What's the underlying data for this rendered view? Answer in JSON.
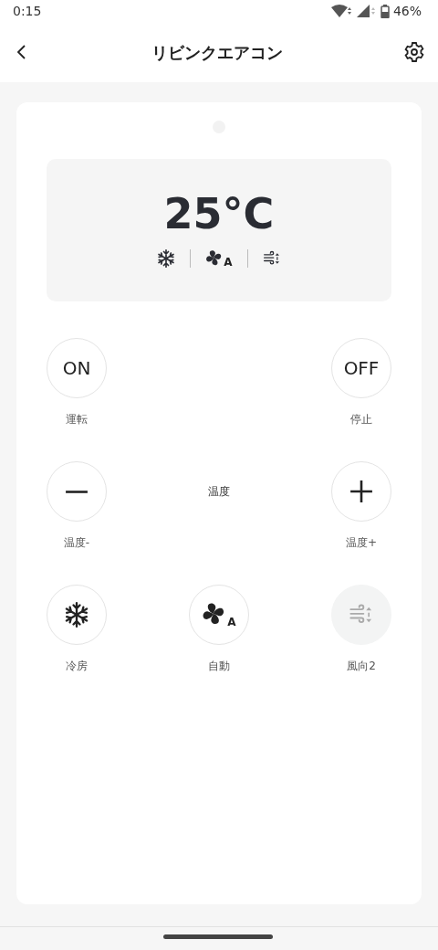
{
  "status_bar": {
    "time": "0:15",
    "battery": "46%"
  },
  "header": {
    "title": "リビンクエアコン"
  },
  "display": {
    "temperature": "25°C",
    "indicators": [
      {
        "kind": "snowflake"
      },
      {
        "kind": "fan",
        "letter": "A"
      },
      {
        "kind": "swing"
      }
    ]
  },
  "rows": [
    {
      "left": {
        "kind": "text",
        "text": "ON",
        "label": "運転",
        "disabled": false
      },
      "right": {
        "kind": "text",
        "text": "OFF",
        "label": "停止",
        "disabled": false
      }
    },
    {
      "left": {
        "kind": "minus",
        "label": "温度-",
        "disabled": false
      },
      "center": {
        "kind": "caption",
        "text": "温度"
      },
      "right": {
        "kind": "plus",
        "label": "温度+",
        "disabled": false
      }
    },
    {
      "left": {
        "kind": "snowflake",
        "label": "冷房",
        "disabled": false
      },
      "center": {
        "kind": "fan",
        "letter": "A",
        "label": "自動",
        "disabled": false
      },
      "right": {
        "kind": "swing",
        "label": "風向2",
        "disabled": true
      }
    }
  ]
}
